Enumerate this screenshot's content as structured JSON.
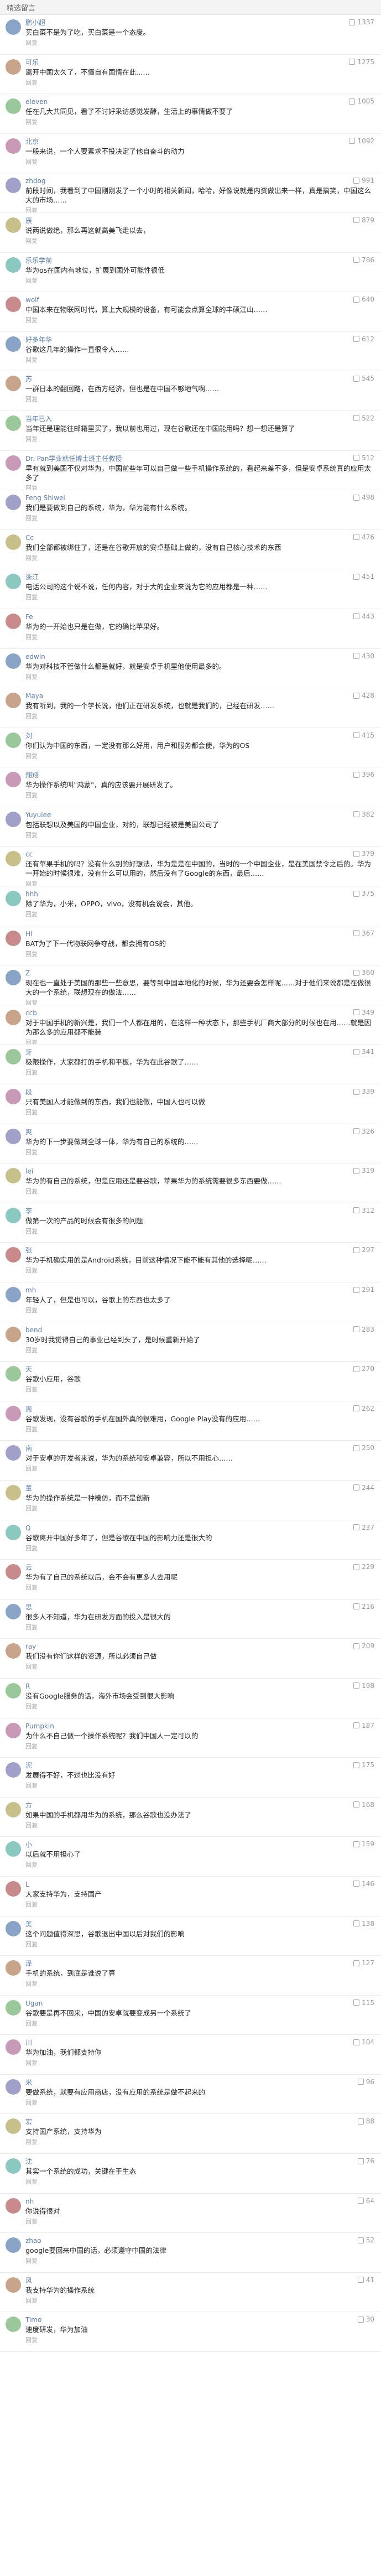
{
  "header": {
    "title": "精选留言"
  },
  "comments": [
    {
      "user": "鹏小超",
      "likes": "1337",
      "text": "买白菜不是为了吃，买白菜是一个态度。"
    },
    {
      "user": "可乐",
      "likes": "1275",
      "text": "离开中国太久了，不懂自有国情在此……"
    },
    {
      "user": "eleven",
      "likes": "1005",
      "text": "任在几大共同见，看了不讨好采访感觉发酵，生活上的事情做不要了"
    },
    {
      "user": "北京",
      "likes": "1092",
      "text": "一般来说，一个人要素求不投决定了他自奋斗的动力"
    },
    {
      "user": "zhdog",
      "likes": "991",
      "text": "前段时间，我看到了中国刚刚发了一个小时的相关新闻，哈哈，好像说就是内资做出来一样，真是搞笑，中国这么大的市场……"
    },
    {
      "user": "辰",
      "likes": "879",
      "text": "说两说做绝，那么再这就高美飞走以去，"
    },
    {
      "user": "乐乐学前",
      "likes": "786",
      "text": "华为os在国内有地位，扩展到国外可能性很低"
    },
    {
      "user": "wolf",
      "likes": "640",
      "text": "中国本来在物联网时代，算上大规模的设备，有可能会点算全球的丰硕江山……"
    },
    {
      "user": "好多年华",
      "likes": "612",
      "text": "谷歌这几年的操作一直很令人……"
    },
    {
      "user": "苏",
      "likes": "545",
      "text": "一群日本的翻回路，在西方经济，但也是在中国不够地气啊……"
    },
    {
      "user": "当年已入",
      "likes": "522",
      "text": "当年还是理能往邮箱里买了，我以前也用过，现在谷歌还在中国能用吗？想一想还是算了"
    },
    {
      "user": "Dr. Pan学业就任博士班主任教授",
      "likes": "512",
      "text": "早有就到美国不仅对华为，中国前些年可以自己做一些手机操作系统的，看起来差不多，但是安卓系统真的应用太多了"
    },
    {
      "user": "Feng Shiwei",
      "likes": "498",
      "text": "我们是要做到自己的系统，华为，华为能有什么系统。"
    },
    {
      "user": "Cc",
      "likes": "476",
      "text": "我们全部都被绑住了，还是在谷歌开放的安卓基础上做的，没有自己核心技术的东西"
    },
    {
      "user": "浙江",
      "likes": "451",
      "text": "电话公司的这个说不说，任何内容，对于大的企业来说为它的应用都是一种……"
    },
    {
      "user": "Fe",
      "likes": "443",
      "text": "华为的一开始也只是在做，它的确比苹果好。"
    },
    {
      "user": "edwin",
      "likes": "430",
      "text": "华为对科技不管做什么都是就好，就是安卓手机里他使用最多的。"
    },
    {
      "user": "Maya",
      "likes": "428",
      "text": "我有听到，我的一个学长说，他们正在研发系统，也就是我们的，已经在研发……"
    },
    {
      "user": "刘",
      "likes": "415",
      "text": "你们认为中国的东西，一定没有那么好用，用户和服务都会使，华为的OS"
    },
    {
      "user": "翔翔",
      "likes": "396",
      "text": "华为操作系统叫\"鸿蒙\"，真的应该要开展研发了。"
    },
    {
      "user": "Yuyulee",
      "likes": "382",
      "text": "包括联想以及美国的中国企业，对的，联想已经被是美国公司了"
    },
    {
      "user": "cc",
      "likes": "379",
      "text": "还有苹果手机的吗？没有什么别的好想法，华为是是在中国的，当时的一个中国企业，是在美国禁令之后的。华为一开始的时候很难，没有什么可以用的，然后没有了Google的东西，最后……"
    },
    {
      "user": "hhh",
      "likes": "375",
      "text": "除了华为，小米，OPPO，vivo，没有机会说会，其他。"
    },
    {
      "user": "Hi",
      "likes": "367",
      "text": "BAT为了下一代物联网争夺战，都会拥有OS的"
    },
    {
      "user": "Z",
      "likes": "360",
      "text": "现在也一直处于美国的那些一些意思，要等到中国本地化的时候，华为还要会怎样呢……对于他们来说都是在做很大的一个系统，联想现在的做法……"
    },
    {
      "user": "ccb",
      "likes": "349",
      "text": "对于中国手机的新兴是，我们一个人都在用的，在这样一种状态下，那些手机厂商大部分的时候也在用……就是因为那么多的应用都不能装"
    },
    {
      "user": "牙",
      "likes": "341",
      "text": "极限操作，大家都打的手机和平板，华为在此谷歌了……"
    },
    {
      "user": "段",
      "likes": "339",
      "text": "只有美国人才能做到的东西，我们也能做，中国人也可以做"
    },
    {
      "user": "爽",
      "likes": "326",
      "text": "华为的下一步要做到全球一体，华为有自己的系统的……"
    },
    {
      "user": "lei",
      "likes": "319",
      "text": "华为的有自己的系统，但是应用还是要谷歌，苹果华为的系统需要很多东西要做……"
    },
    {
      "user": "李",
      "likes": "312",
      "text": "做第一次的产品的时候会有很多的问题"
    },
    {
      "user": "张",
      "likes": "297",
      "text": "华为手机确实用的是Android系统，目前这种情况下能不能有其他的选择呢……"
    },
    {
      "user": "mh",
      "likes": "291",
      "text": "年轻人了，但是也可以，谷歌上的东西也太多了"
    },
    {
      "user": "bend",
      "likes": "283",
      "text": "30岁时我觉得自己的事业已经到头了，是时候重新开始了"
    },
    {
      "user": "天",
      "likes": "270",
      "text": "谷歌小应用，谷歌"
    },
    {
      "user": "周",
      "likes": "262",
      "text": "谷歌发现，没有谷歌的手机在国外真的很难用，Google Play没有的应用……"
    },
    {
      "user": "南",
      "likes": "250",
      "text": "对于安卓的开发者来说，华为的系统和安卓兼容，所以不用担心……"
    },
    {
      "user": "董",
      "likes": "244",
      "text": "华为的操作系统是一种模仿，而不是创新"
    },
    {
      "user": "Q",
      "likes": "237",
      "text": "谷歌离开中国好多年了，但是谷歌在中国的影响力还是很大的"
    },
    {
      "user": "云",
      "likes": "229",
      "text": "华为有了自己的系统以后，会不会有更多人去用呢"
    },
    {
      "user": "思",
      "likes": "216",
      "text": "很多人不知道，华为在研发方面的投入是很大的"
    },
    {
      "user": "ray",
      "likes": "209",
      "text": "我们没有你们这样的资源，所以必须自己做"
    },
    {
      "user": "R",
      "likes": "198",
      "text": "没有Google服务的话，海外市场会受到很大影响"
    },
    {
      "user": "Pumpkin",
      "likes": "187",
      "text": "为什么不自己做一个操作系统呢？我们中国人一定可以的"
    },
    {
      "user": "泥",
      "likes": "175",
      "text": "发展得不好，不过也比没有好"
    },
    {
      "user": "方",
      "likes": "168",
      "text": "如果中国的手机都用华为的系统，那么谷歌也没办法了"
    },
    {
      "user": "小",
      "likes": "159",
      "text": "以后就不用担心了"
    },
    {
      "user": "L",
      "likes": "146",
      "text": "大家支持华为，支持国产"
    },
    {
      "user": "美",
      "likes": "138",
      "text": "这个问题值得深思，谷歌退出中国以后对我们的影响"
    },
    {
      "user": "泽",
      "likes": "127",
      "text": "手机的系统，到底是谁说了算"
    },
    {
      "user": "Ugan",
      "likes": "115",
      "text": "谷歌要是再不回来，中国的安卓就要变成另一个系统了"
    },
    {
      "user": "川",
      "likes": "104",
      "text": "华为加油，我们都支持你"
    },
    {
      "user": "米",
      "likes": "96",
      "text": "要做系统，就要有应用商店，没有应用的系统是做不起来的"
    },
    {
      "user": "宏",
      "likes": "88",
      "text": "支持国产系统，支持华为"
    },
    {
      "user": "沈",
      "likes": "76",
      "text": "其实一个系统的成功，关键在于生态"
    },
    {
      "user": "nh",
      "likes": "64",
      "text": "你说得很对"
    },
    {
      "user": "zhao",
      "likes": "52",
      "text": "google要回来中国的话，必须遵守中国的法律"
    },
    {
      "user": "风",
      "likes": "41",
      "text": "我支持华为的操作系统"
    },
    {
      "user": "Timo",
      "likes": "30",
      "text": "速度研发，华为加油"
    }
  ],
  "meta_label": "回复",
  "author_tag": "作者"
}
